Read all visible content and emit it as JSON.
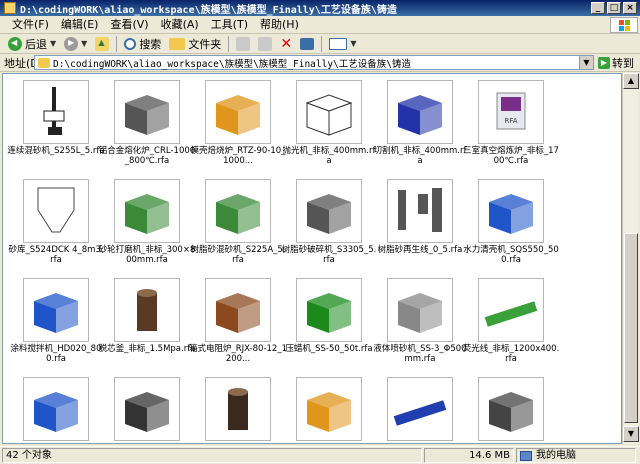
{
  "window": {
    "title": "D:\\codingWORK\\aliao_workspace\\族模型\\族模型_Finally\\工艺设备族\\铸造",
    "controls": {
      "minimize": "_",
      "maximize": "□",
      "close": "×"
    }
  },
  "menu": [
    "文件(F)",
    "编辑(E)",
    "查看(V)",
    "收藏(A)",
    "工具(T)",
    "帮助(H)"
  ],
  "toolbar": {
    "back_label": "后退",
    "search_label": "搜索",
    "folders_label": "文件夹",
    "delete_glyph": "✕"
  },
  "address": {
    "label": "地址(D)",
    "value": "D:\\codingWORK\\aliao_workspace\\族模型\\族模型_Finally\\工艺设备族\\铸造",
    "go_label": "转到"
  },
  "items": [
    {
      "label": "连续混砂机_S255L_5.rfa",
      "icon": "gantry-mixer-icon",
      "color": "#222222"
    },
    {
      "label": "铝合金熔化炉_CRL-1000_800℃.rfa",
      "icon": "gray-furnace-icon",
      "color": "#555555"
    },
    {
      "label": "模壳焙烧炉_RTZ-90-10_1000...",
      "icon": "orange-box-icon",
      "color": "#e0961c"
    },
    {
      "label": "抛光机_非标_400mm.rfa",
      "icon": "wire-box-icon",
      "color": "#ffffff"
    },
    {
      "label": "切割机_非标_400mm.rfa",
      "icon": "cutting-machine-icon",
      "color": "#2233aa"
    },
    {
      "label": "三室真空熔炼炉_非标_1700℃.rfa",
      "icon": "rfa-file-icon",
      "color": "#7a2e8a"
    },
    {
      "label": "砂库_S524DCK 4_8m3.rfa",
      "icon": "silo-icon",
      "color": "#444444"
    },
    {
      "label": "砂轮打磨机_非标_300×800mm.rfa",
      "icon": "grinder-icon",
      "color": "#3a8a3a"
    },
    {
      "label": "树脂砂混砂机_S225A_5.rfa",
      "icon": "resin-mixer-icon",
      "color": "#3a8a3a"
    },
    {
      "label": "树脂砂破碎机_S3305_5.rfa",
      "icon": "crusher-icon",
      "color": "#555555"
    },
    {
      "label": "树脂砂再生线_0_5.rfa",
      "icon": "regeneration-line-icon",
      "color": "#555555"
    },
    {
      "label": "水力清壳机_SQS550_500.rfa",
      "icon": "water-cleaner-icon",
      "color": "#1f55c8"
    },
    {
      "label": "涂料搅拌机_HD020_800.rfa",
      "icon": "blue-cabinet-icon",
      "color": "#1f55c8"
    },
    {
      "label": "脱芯釜_非标_1.5Mpa.rfa",
      "icon": "cylinder-icon",
      "color": "#5a3a22"
    },
    {
      "label": "箱式电阻炉_RJX-80-12_1200...",
      "icon": "brown-box-icon",
      "color": "#8b4a1e"
    },
    {
      "label": "压蜡机_SS-50_50t.rfa",
      "icon": "wax-press-icon",
      "color": "#1b8a1b"
    },
    {
      "label": "液体喷砂机_SS-3_Φ500mm.rfa",
      "icon": "sandblaster-icon",
      "color": "#888888"
    },
    {
      "label": "荧光线_非标_1200x400.rfa",
      "icon": "fluorescent-line-icon",
      "color": "#3aa13a"
    },
    {
      "label": "",
      "icon": "blue-machine-icon",
      "color": "#1f55c8"
    },
    {
      "label": "",
      "icon": "tall-cabinet-icon",
      "color": "#333333"
    },
    {
      "label": "",
      "icon": "dark-cylinder-icon",
      "color": "#3a2a1e"
    },
    {
      "label": "",
      "icon": "orange-block-icon",
      "color": "#e0961c"
    },
    {
      "label": "",
      "icon": "blue-conveyor-icon",
      "color": "#1f3fb0"
    },
    {
      "label": "",
      "icon": "small-press-icon",
      "color": "#444444"
    }
  ],
  "status": {
    "count": "42 个对象",
    "size": "14.6 MB",
    "zone": "我的电脑"
  }
}
